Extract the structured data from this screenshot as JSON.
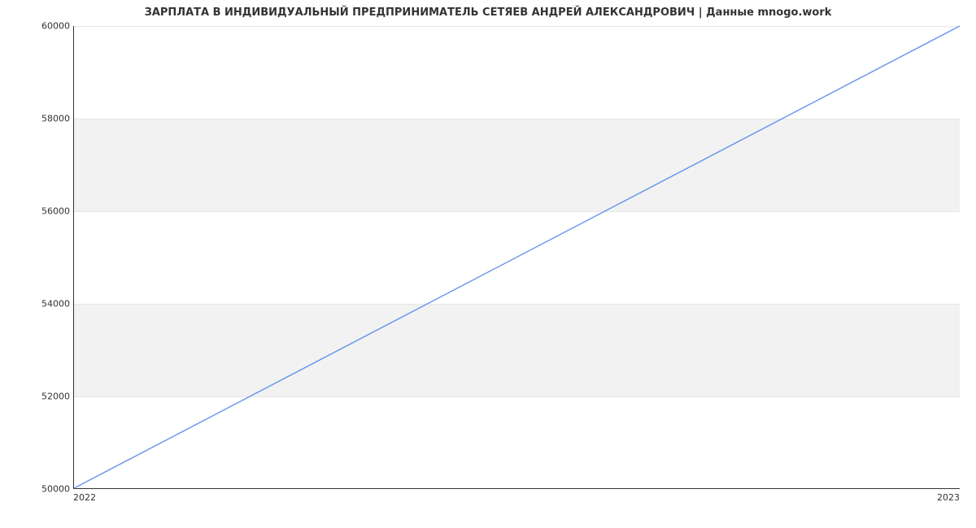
{
  "chart_data": {
    "type": "line",
    "title": "ЗАРПЛАТА В ИНДИВИДУАЛЬНЫЙ ПРЕДПРИНИМАТЕЛЬ СЕТЯЕВ АНДРЕЙ АЛЕКСАНДРОВИЧ | Данные mnogo.work",
    "x": [
      "2022",
      "2023"
    ],
    "series": [
      {
        "name": "salary",
        "values": [
          50000,
          60000
        ],
        "color": "#6495ed"
      }
    ],
    "xlabel": "",
    "ylabel": "",
    "ylim": [
      50000,
      60000
    ],
    "yticks": [
      50000,
      52000,
      54000,
      56000,
      58000,
      60000
    ],
    "xticks": [
      "2022",
      "2023"
    ],
    "bands": [
      {
        "from": 52000,
        "to": 54000
      },
      {
        "from": 56000,
        "to": 58000
      }
    ],
    "grid": true
  }
}
